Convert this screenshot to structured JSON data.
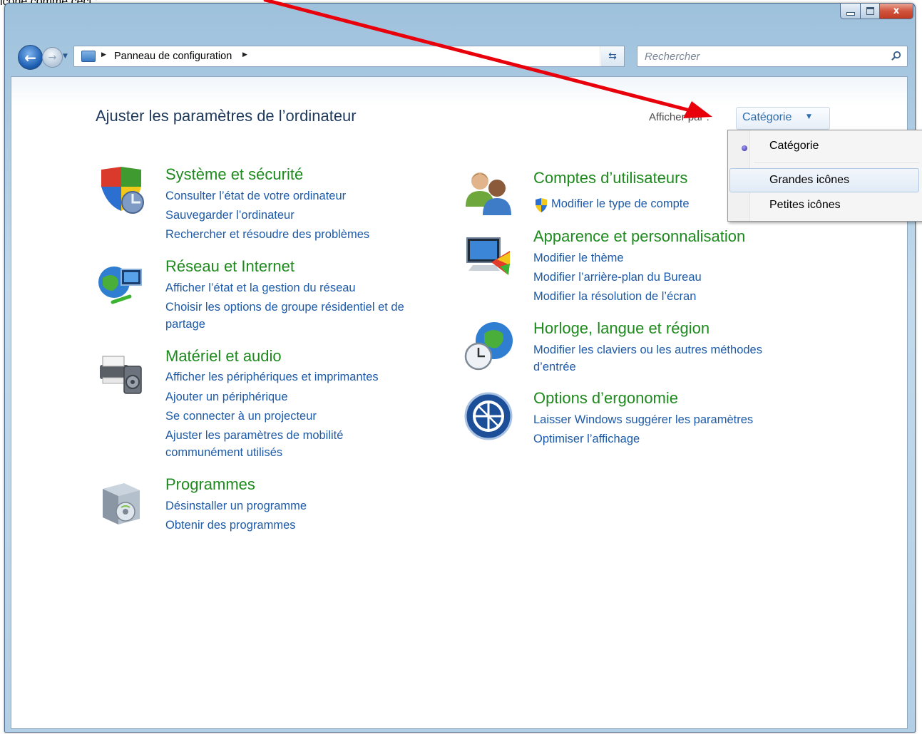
{
  "caption": "icône comme ceci :",
  "window": {
    "controls": {
      "minimize_icon": "minimize-icon",
      "maximize_icon": "maximize-icon",
      "close_glyph": "x"
    }
  },
  "navbar": {
    "breadcrumb": "Panneau de configuration",
    "search_placeholder": "Rechercher"
  },
  "page": {
    "title": "Ajuster les paramètres de l’ordinateur",
    "view_by_label": "Afficher par :",
    "view_by_value": "Catégorie"
  },
  "view_menu": {
    "items": [
      {
        "label": "Catégorie",
        "selected": true
      },
      {
        "label": "Grandes icônes",
        "highlighted": true
      },
      {
        "label": "Petites icônes"
      }
    ]
  },
  "categories": {
    "systeme": {
      "title": "Système et sécurité",
      "icon": "security-shield-icon",
      "links": [
        "Consulter l’état de votre ordinateur",
        "Sauvegarder l’ordinateur",
        "Rechercher et résoudre des problèmes"
      ]
    },
    "reseau": {
      "title": "Réseau et Internet",
      "icon": "network-globe-icon",
      "links": [
        "Afficher l’état et la gestion du réseau",
        "Choisir les options de groupe résidentiel et de",
        "partage"
      ]
    },
    "materiel": {
      "title": "Matériel et audio",
      "icon": "printer-speaker-icon",
      "links": [
        "Afficher les périphériques et imprimantes",
        "Ajouter un périphérique",
        "Se connecter à un projecteur",
        "Ajuster les paramètres de mobilité",
        "communément utilisés"
      ]
    },
    "programmes": {
      "title": "Programmes",
      "icon": "programs-box-icon",
      "links": [
        "Désinstaller un programme",
        "Obtenir des programmes"
      ]
    },
    "comptes": {
      "title": "Comptes d’utilisateurs",
      "icon": "users-icon",
      "links": [
        "Modifier le type de compte"
      ]
    },
    "apparence": {
      "title": "Apparence et personnalisation",
      "icon": "monitor-palette-icon",
      "links": [
        "Modifier le thème",
        "Modifier l’arrière-plan du Bureau",
        "Modifier la résolution de l’écran"
      ]
    },
    "horloge": {
      "title": "Horloge, langue et région",
      "icon": "clock-globe-icon",
      "links": [
        "Modifier les claviers ou les autres méthodes",
        "d’entrée"
      ]
    },
    "ergonomie": {
      "title": "Options d’ergonomie",
      "icon": "accessibility-icon",
      "links": [
        "Laisser Windows suggérer les paramètres",
        "Optimiser l’affichage"
      ]
    }
  },
  "colors": {
    "category_title": "#1e8a1e",
    "link": "#1d5aa7",
    "annotation_arrow": "#e8000b"
  }
}
